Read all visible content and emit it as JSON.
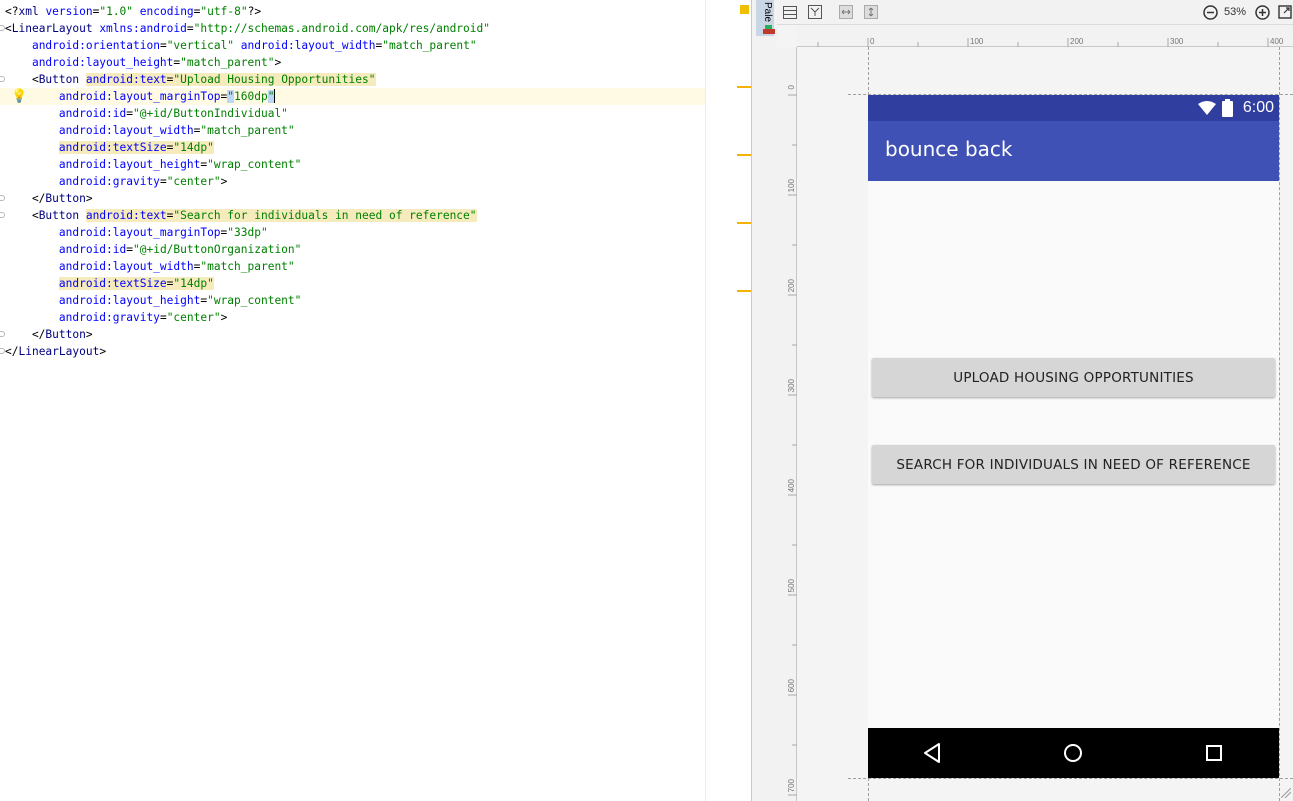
{
  "editor": {
    "lines": [
      [
        [
          "p",
          "<?"
        ],
        [
          "t",
          "xml "
        ],
        [
          "a",
          "version"
        ],
        [
          "p",
          "="
        ],
        [
          "v",
          "\"1.0\""
        ],
        [
          "p",
          " "
        ],
        [
          "a",
          "encoding"
        ],
        [
          "p",
          "="
        ],
        [
          "v",
          "\"utf-8\""
        ],
        [
          "p",
          "?>"
        ]
      ],
      [
        [
          "p",
          "<"
        ],
        [
          "t",
          "LinearLayout "
        ],
        [
          "a",
          "xmlns:android"
        ],
        [
          "p",
          "="
        ],
        [
          "v",
          "\"http://schemas.android.com/apk/res/android\""
        ]
      ],
      [
        [
          "p",
          "    "
        ],
        [
          "a",
          "android:orientation"
        ],
        [
          "p",
          "="
        ],
        [
          "v",
          "\"vertical\""
        ],
        [
          "p",
          " "
        ],
        [
          "a",
          "android:layout_width"
        ],
        [
          "p",
          "="
        ],
        [
          "v",
          "\"match_parent\""
        ]
      ],
      [
        [
          "p",
          "    "
        ],
        [
          "a",
          "android:layout_height"
        ],
        [
          "p",
          "="
        ],
        [
          "v",
          "\"match_parent\""
        ],
        [
          "p",
          ">"
        ]
      ],
      [
        [
          "p",
          "    <"
        ],
        [
          "t",
          "Button "
        ],
        [
          "a hl",
          "android:text"
        ],
        [
          "p hl",
          "="
        ],
        [
          "v hl",
          "\"Upload Housing Opportunities\""
        ]
      ],
      [
        [
          "p",
          "        "
        ],
        [
          "a",
          "android:layout_marginTop"
        ],
        [
          "p",
          "="
        ],
        [
          "v sel",
          "\""
        ],
        [
          "v",
          "160dp"
        ],
        [
          "v sel",
          "\""
        ],
        [
          "caret",
          ""
        ]
      ],
      [
        [
          "p",
          "        "
        ],
        [
          "a",
          "android:id"
        ],
        [
          "p",
          "="
        ],
        [
          "v",
          "\"@+id/ButtonIndividual\""
        ]
      ],
      [
        [
          "p",
          "        "
        ],
        [
          "a",
          "android:layout_width"
        ],
        [
          "p",
          "="
        ],
        [
          "v",
          "\"match_parent\""
        ]
      ],
      [
        [
          "p",
          "        "
        ],
        [
          "a hl",
          "android:textSize"
        ],
        [
          "p hl",
          "="
        ],
        [
          "v hl",
          "\"14dp\""
        ]
      ],
      [
        [
          "p",
          "        "
        ],
        [
          "a",
          "android:layout_height"
        ],
        [
          "p",
          "="
        ],
        [
          "v",
          "\"wrap_content\""
        ]
      ],
      [
        [
          "p",
          "        "
        ],
        [
          "a",
          "android:gravity"
        ],
        [
          "p",
          "="
        ],
        [
          "v",
          "\"center\""
        ],
        [
          "p",
          ">"
        ]
      ],
      [
        [
          "p",
          "    </"
        ],
        [
          "t",
          "Button"
        ],
        [
          "p",
          ">"
        ]
      ],
      [
        [
          "p",
          "    <"
        ],
        [
          "t",
          "Button "
        ],
        [
          "a hl",
          "android:text"
        ],
        [
          "p hl",
          "="
        ],
        [
          "v hl",
          "\"Search for individuals in need of reference\""
        ]
      ],
      [
        [
          "p",
          "        "
        ],
        [
          "a",
          "android:layout_marginTop"
        ],
        [
          "p",
          "="
        ],
        [
          "v",
          "\"33dp\""
        ]
      ],
      [
        [
          "p",
          "        "
        ],
        [
          "a",
          "android:id"
        ],
        [
          "p",
          "="
        ],
        [
          "v",
          "\"@+id/ButtonOrganization\""
        ]
      ],
      [
        [
          "p",
          "        "
        ],
        [
          "a",
          "android:layout_width"
        ],
        [
          "p",
          "="
        ],
        [
          "v",
          "\"match_parent\""
        ]
      ],
      [
        [
          "p",
          "        "
        ],
        [
          "a hl",
          "android:textSize"
        ],
        [
          "p hl",
          "="
        ],
        [
          "v hl",
          "\"14dp\""
        ]
      ],
      [
        [
          "p",
          "        "
        ],
        [
          "a",
          "android:layout_height"
        ],
        [
          "p",
          "="
        ],
        [
          "v",
          "\"wrap_content\""
        ]
      ],
      [
        [
          "p",
          "        "
        ],
        [
          "a",
          "android:gravity"
        ],
        [
          "p",
          "="
        ],
        [
          "v",
          "\"center\""
        ],
        [
          "p",
          ">"
        ]
      ],
      [
        [
          "p",
          "    </"
        ],
        [
          "t",
          "Button"
        ],
        [
          "p",
          ">"
        ]
      ],
      [
        [
          "p",
          "</"
        ],
        [
          "t",
          "LinearLayout"
        ],
        [
          "p",
          ">"
        ]
      ]
    ]
  },
  "palette": {
    "label": "Pale"
  },
  "toolbar": {
    "zoom": "53%"
  },
  "ruler": {
    "top_ticks": [
      "0",
      "100",
      "200",
      "300",
      "400"
    ],
    "left_ticks": [
      "0",
      "100",
      "200",
      "300",
      "400",
      "500",
      "600",
      "700"
    ]
  },
  "phone": {
    "status_time": "6:00",
    "app_title": "bounce back",
    "button_upload": "UPLOAD HOUSING OPPORTUNITIES",
    "button_search": "SEARCH FOR INDIVIDUALS IN NEED OF REFERENCE"
  },
  "colors": {
    "status_bar": "#303f9f",
    "app_bar": "#3f51b5",
    "button": "#d6d6d6",
    "nav_bar": "#000000"
  }
}
